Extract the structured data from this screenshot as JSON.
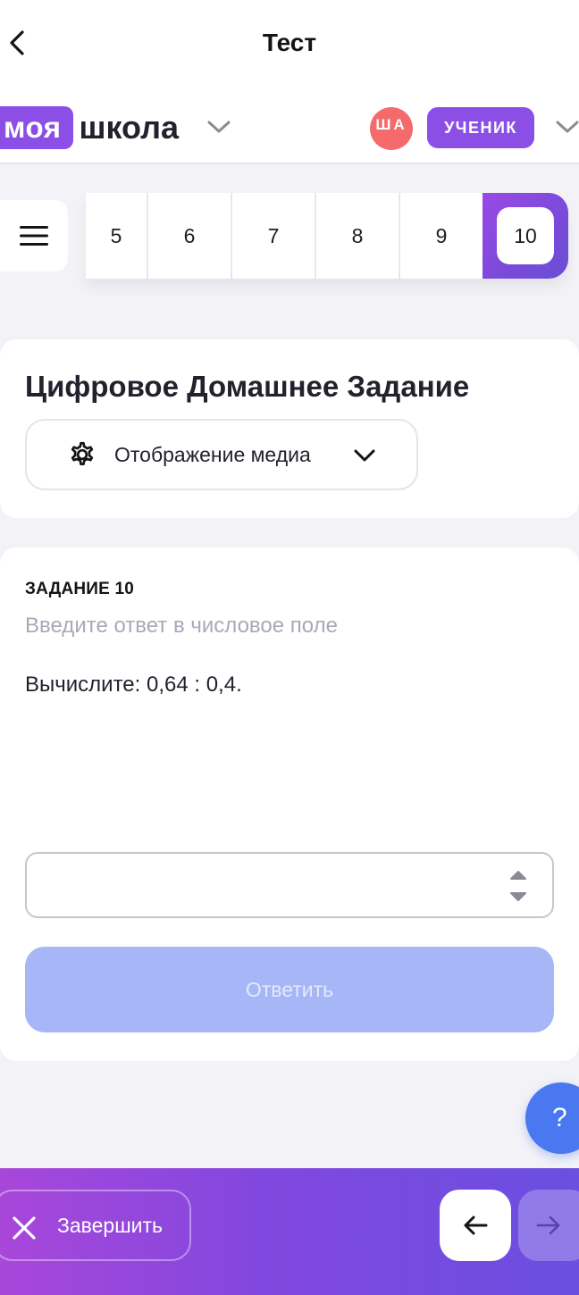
{
  "header": {
    "title": "Тест",
    "back_icon": "chevron-left-icon"
  },
  "brand": {
    "logo_part1": "моя",
    "logo_part2": "школа",
    "avatar_initials": "ША",
    "role": "УЧЕНИК"
  },
  "question_nav": {
    "menu_icon": "hamburger-icon",
    "tabs": [
      {
        "label": "5"
      },
      {
        "label": "6"
      },
      {
        "label": "7"
      },
      {
        "label": "8"
      },
      {
        "label": "9"
      },
      {
        "label": "10"
      }
    ],
    "active": "10"
  },
  "homework": {
    "title": "Цифровое Домашнее Задание",
    "media_display_label": "Отображение медиа"
  },
  "task": {
    "label": "ЗАДАНИЕ 10",
    "hint": "Введите ответ в числовое поле",
    "question": "Вычислите: 0,64 : 0,4.",
    "answer_value": "",
    "submit_label": "Ответить"
  },
  "help": {
    "label": "?"
  },
  "footer": {
    "finish_label": "Завершить",
    "prev_icon": "arrow-left-icon",
    "next_icon": "arrow-right-icon"
  },
  "colors": {
    "accent_purple": "#8b4fe6",
    "avatar_red": "#f56a6a",
    "submit_disabled": "#a6b6f7",
    "help_blue": "#4a78f0",
    "background": "#f2f2f7"
  }
}
